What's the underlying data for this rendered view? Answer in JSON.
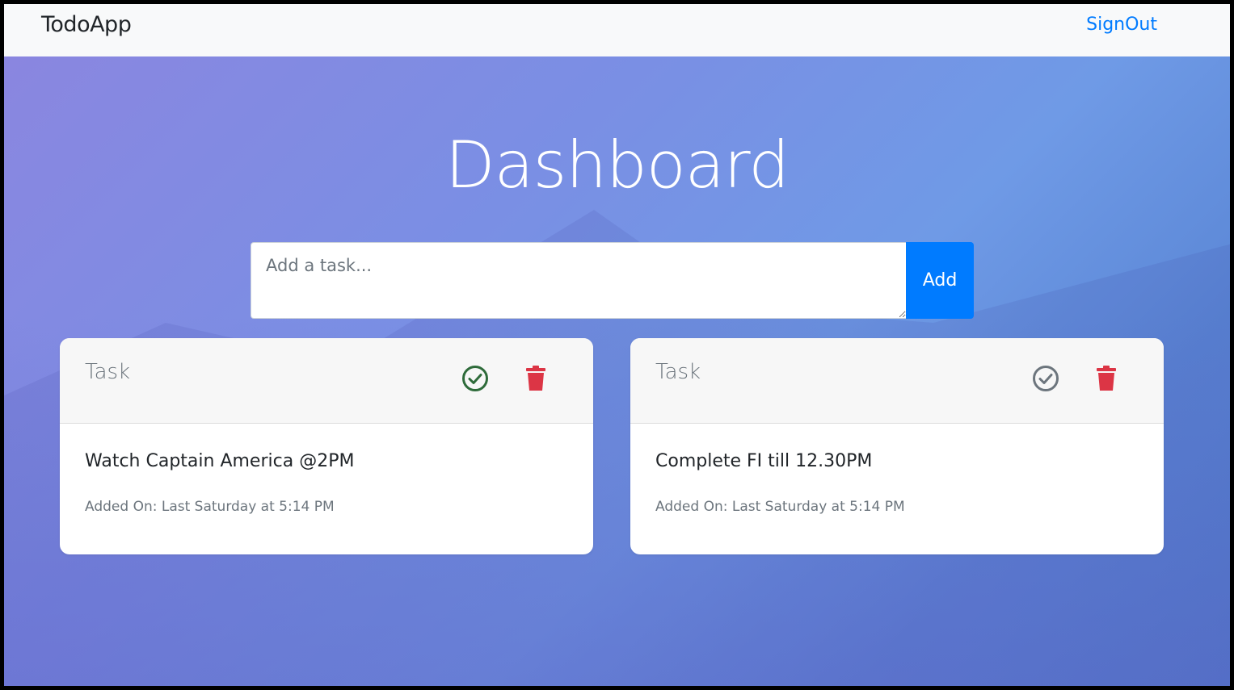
{
  "navbar": {
    "brand": "TodoApp",
    "signout_label": "SignOut"
  },
  "hero": {
    "title": "Dashboard"
  },
  "task_form": {
    "placeholder": "Add a task...",
    "value": "",
    "add_label": "Add"
  },
  "tasks": [
    {
      "header": "Task",
      "text": "Watch Captain America @2PM",
      "added_on": "Added On: Last Saturday at 5:14 PM",
      "complete_icon": "check-circle-icon",
      "delete_icon": "trash-icon"
    },
    {
      "header": "Task",
      "text": "Complete FI till 12.30PM",
      "added_on": "Added On: Last Saturday at 5:14 PM",
      "complete_icon": "check-circle-icon",
      "delete_icon": "trash-icon"
    }
  ],
  "colors": {
    "accent": "#007bff",
    "danger": "#dc3545",
    "success": "#2e6b3a",
    "muted_icon": "#6c757d"
  }
}
